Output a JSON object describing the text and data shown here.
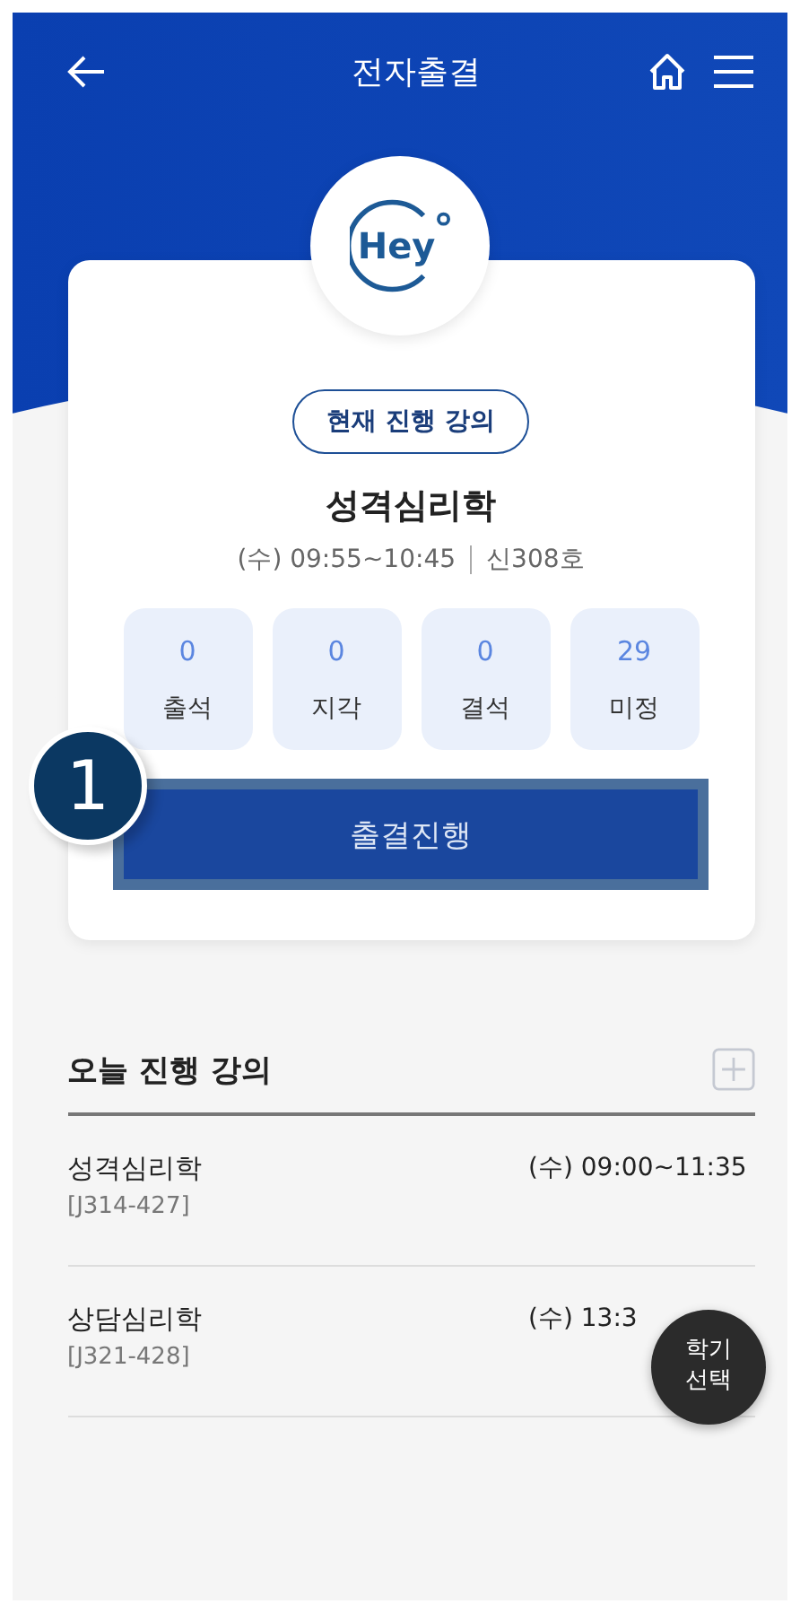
{
  "top_bar": {
    "title": "전자출결"
  },
  "logo": {
    "text": "Hey"
  },
  "current_lecture": {
    "badge": "현재 진행 강의",
    "name": "성격심리학",
    "time": "(수) 09:55~10:45",
    "room": "신308호",
    "stats": [
      {
        "value": "0",
        "label": "출석"
      },
      {
        "value": "0",
        "label": "지각"
      },
      {
        "value": "0",
        "label": "결석"
      },
      {
        "value": "29",
        "label": "미정"
      }
    ],
    "action_button": "출결진행"
  },
  "callout": {
    "number": "1"
  },
  "today": {
    "title": "오늘 진행 강의",
    "lectures": [
      {
        "name": "성격심리학",
        "code": "[J314-427]",
        "time": "(수) 09:00~11:35"
      },
      {
        "name": "상담심리학",
        "code": "[J321-428]",
        "time": "(수) 13:3"
      }
    ]
  },
  "fab": {
    "lines": [
      "학기",
      "선택"
    ]
  }
}
